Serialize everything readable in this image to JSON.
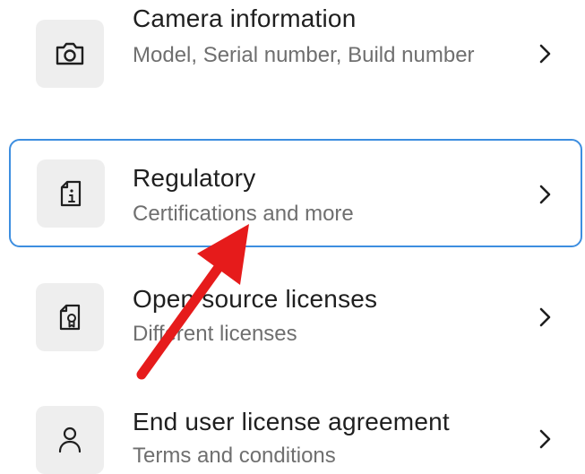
{
  "settings": {
    "items": [
      {
        "title": "Camera information",
        "subtitle": "Model, Serial number, Build number",
        "icon": "camera-icon",
        "selected": false
      },
      {
        "title": "Regulatory",
        "subtitle": "Certifications and more",
        "icon": "document-info-icon",
        "selected": true
      },
      {
        "title": "Open source licenses",
        "subtitle": "Different licenses",
        "icon": "document-certificate-icon",
        "selected": false
      },
      {
        "title": "End user license agreement",
        "subtitle": "Terms and conditions",
        "icon": "person-icon",
        "selected": false
      }
    ]
  },
  "colors": {
    "selection_border": "#3d8ee0",
    "icon_tile": "#eeeeee",
    "annotation_arrow": "#e61b1b",
    "title_text": "#1f1f1f",
    "subtitle_text": "#6f6f6f"
  }
}
